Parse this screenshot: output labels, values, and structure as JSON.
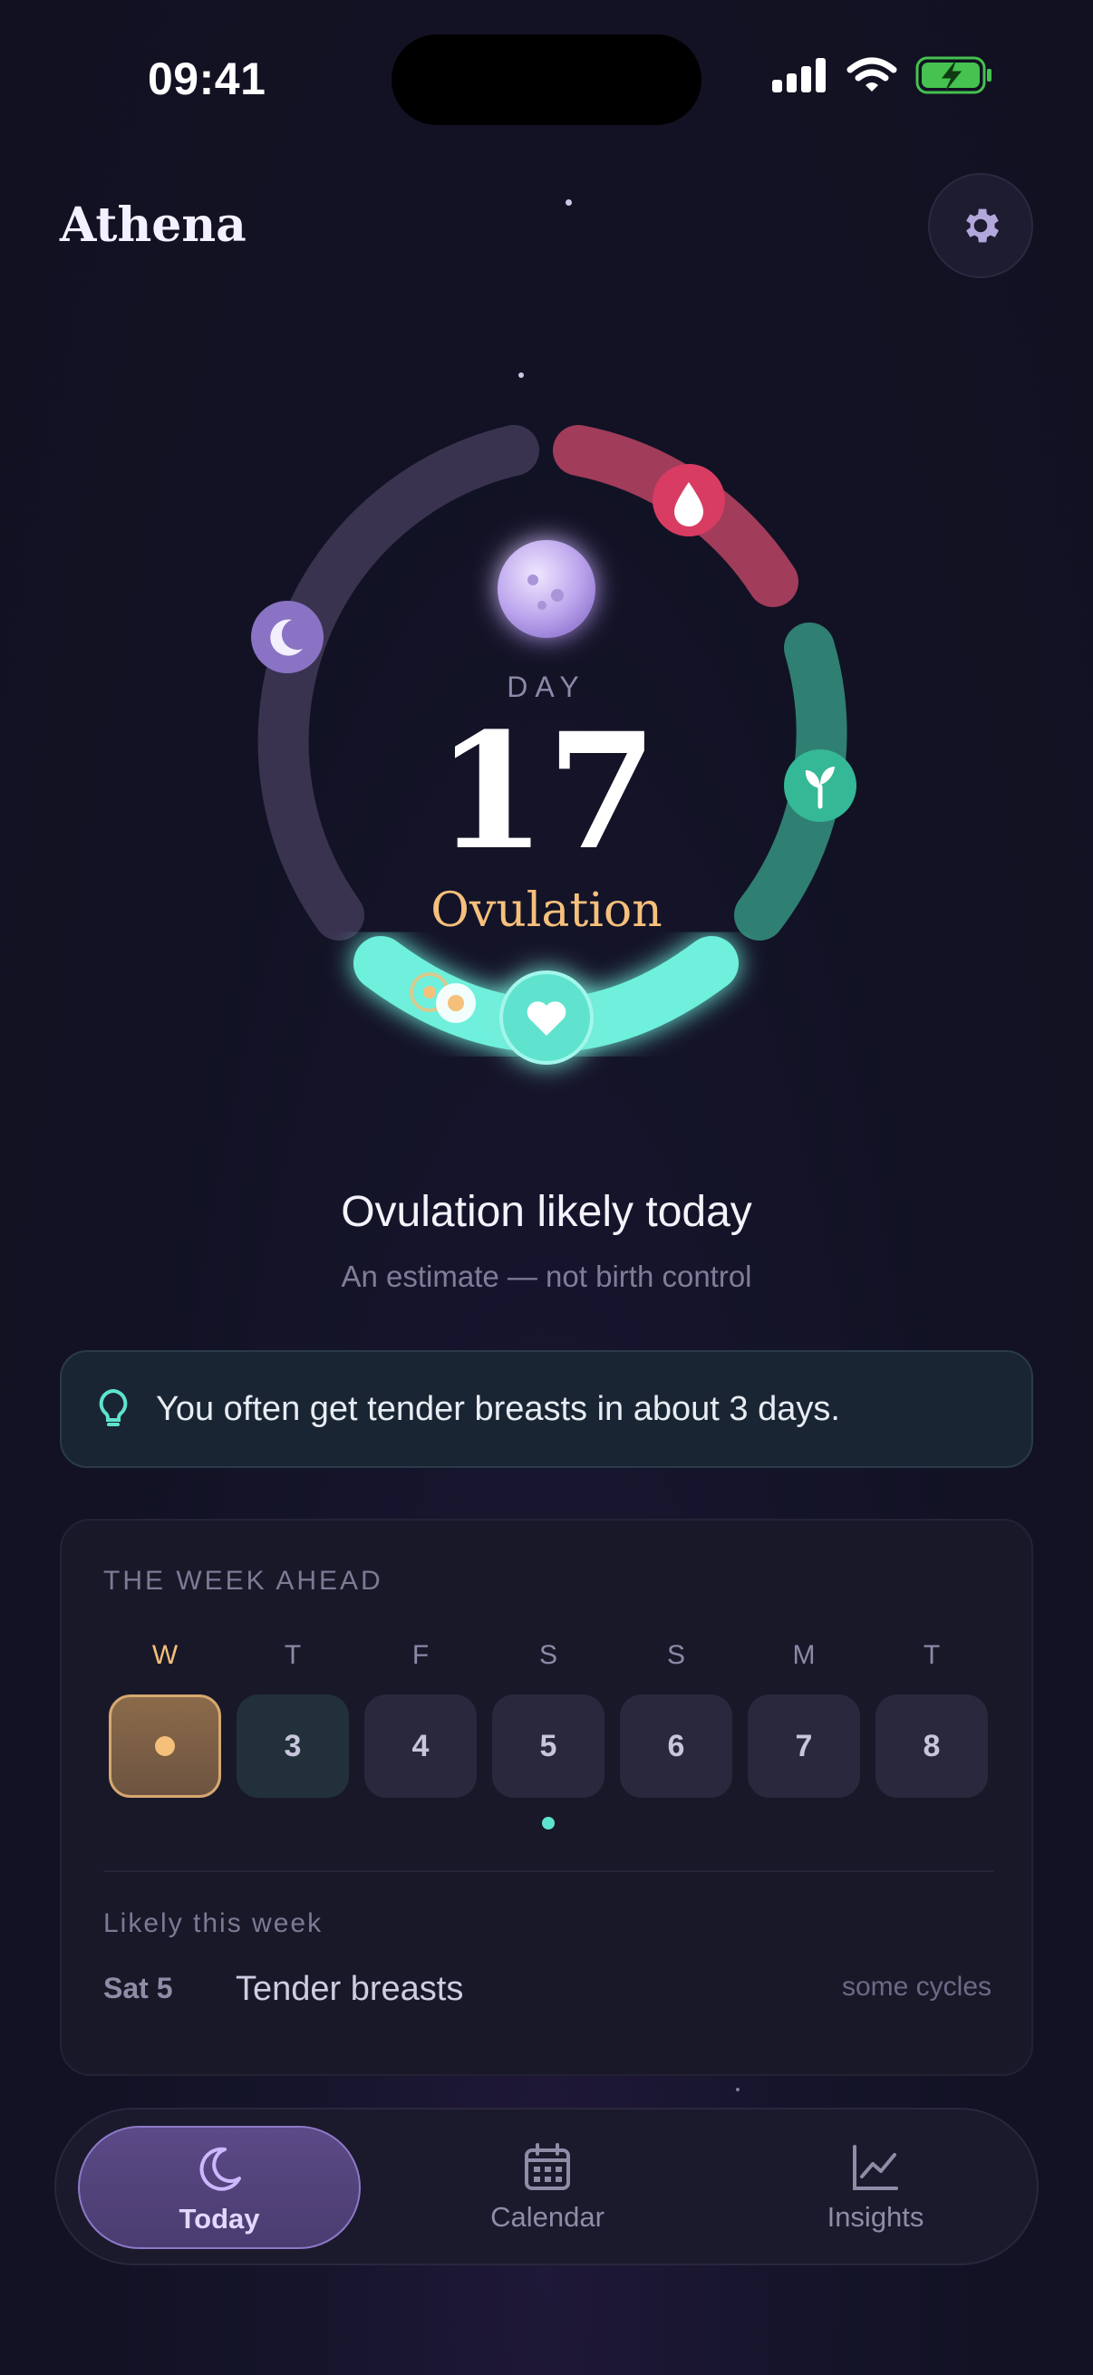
{
  "status_bar": {
    "time": "09:41"
  },
  "header": {
    "app_title": "Athena"
  },
  "cycle": {
    "day_label": "DAY",
    "day_number": "17",
    "phase": "Ovulation"
  },
  "status": {
    "headline": "Ovulation likely today",
    "disclaimer": "An estimate — not birth control"
  },
  "insight": {
    "text": "You often get tender breasts in about 3 days."
  },
  "week": {
    "title": "THE WEEK AHEAD",
    "days": [
      {
        "letter": "W",
        "value": ""
      },
      {
        "letter": "T",
        "value": "3"
      },
      {
        "letter": "F",
        "value": "4"
      },
      {
        "letter": "S",
        "value": "5"
      },
      {
        "letter": "S",
        "value": "6"
      },
      {
        "letter": "M",
        "value": "7"
      },
      {
        "letter": "T",
        "value": "8"
      }
    ],
    "likely_title": "Likely this week",
    "likely": {
      "date": "Sat 5",
      "symptom": "Tender breasts",
      "frequency": "some cycles"
    }
  },
  "tabs": [
    {
      "label": "Today",
      "icon": "moon-icon"
    },
    {
      "label": "Calendar",
      "icon": "calendar-icon"
    },
    {
      "label": "Insights",
      "icon": "chart-icon"
    }
  ],
  "colors": {
    "menstrual": "#c94a6a",
    "fertile": "#3fb79a",
    "ovulation": "#6ef0dc",
    "luteal": "#3b3455",
    "accent_gold": "#f6c07c"
  }
}
